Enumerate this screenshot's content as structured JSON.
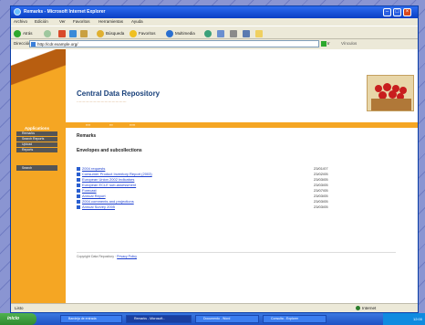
{
  "window": {
    "title": "Remarks - Microsoft Internet Explorer"
  },
  "menu": [
    "Archivo",
    "Edición",
    "Ver",
    "Favoritos",
    "Herramientas",
    "Ayuda"
  ],
  "toolbar": {
    "back_label": "Atrás",
    "search_label": "Búsqueda",
    "favorites_label": "Favoritos",
    "media_label": "Multimedia"
  },
  "address": {
    "label": "Dirección",
    "url": "http://cdr.example.org/",
    "go_label": "Ir",
    "links_label": "Vínculos"
  },
  "site": {
    "title": "Central Data Repository"
  },
  "nav": {
    "heading": "Applications",
    "items": [
      "Remarks",
      "Search Reports",
      "Upload",
      "Reports"
    ],
    "search_label": "Search"
  },
  "page": {
    "breadcrumb": "Remarks",
    "section_title": "Envelopes and subcollections"
  },
  "documents": [
    {
      "name": "2004 requests",
      "date": "23/01/07"
    },
    {
      "name": "Consumer Product Inventory Report (2003)",
      "date": "23/02/05"
    },
    {
      "name": "European Union 2002 Indicators",
      "date": "23/03/05"
    },
    {
      "name": "European ECLE sub-assessment",
      "date": "23/03/05"
    },
    {
      "name": "Forecast",
      "date": "23/07/05"
    },
    {
      "name": "Annual Report",
      "date": "23/03/05"
    },
    {
      "name": "2004 comments and projections",
      "date": "23/03/05"
    },
    {
      "name": "Annual Survey 2005",
      "date": "23/03/05"
    }
  ],
  "footer": {
    "text": "Copyright Data Repository · ",
    "link": "Privacy Policy"
  },
  "status": {
    "text": "Listo",
    "zone": "Internet"
  },
  "taskbar": {
    "start_label": "inicio",
    "tasks": [
      "Bandeja de entrada",
      "Remarks - Microsoft...",
      "Documento - Word",
      "Consulta - Explorer"
    ],
    "clock": "12:00"
  },
  "colors": {
    "accent": "#f5a623",
    "title_blue": "#18407a",
    "link": "#1c3fd0"
  }
}
